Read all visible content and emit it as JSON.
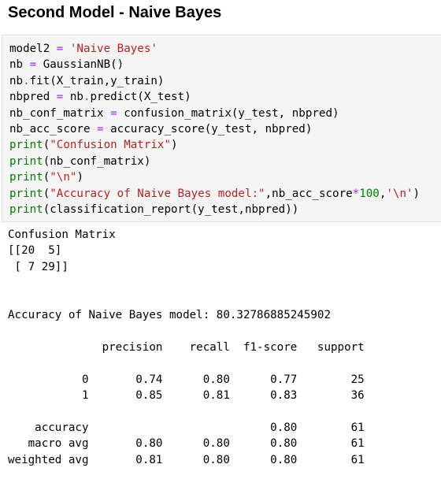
{
  "cell": {
    "heading": "Second Model - Naive Bayes"
  },
  "code": {
    "lines": [
      [
        [
          "v",
          "model2 "
        ],
        [
          "o",
          "="
        ],
        [
          "v",
          " "
        ],
        [
          "s",
          "'Naive Bayes'"
        ]
      ],
      [
        [
          "v",
          "nb "
        ],
        [
          "o",
          "="
        ],
        [
          "v",
          " GaussianNB()"
        ]
      ],
      [
        [
          "v",
          "nb"
        ],
        [
          "o",
          "."
        ],
        [
          "v",
          "fit(X_train,y_train)"
        ]
      ],
      [
        [
          "v",
          "nbpred "
        ],
        [
          "o",
          "="
        ],
        [
          "v",
          " nb"
        ],
        [
          "o",
          "."
        ],
        [
          "v",
          "predict(X_test)"
        ]
      ],
      [
        [
          "v",
          "nb_conf_matrix "
        ],
        [
          "o",
          "="
        ],
        [
          "v",
          " confusion_matrix(y_test, nbpred)"
        ]
      ],
      [
        [
          "v",
          "nb_acc_score "
        ],
        [
          "o",
          "="
        ],
        [
          "v",
          " accuracy_score(y_test, nbpred)"
        ]
      ],
      [
        [
          "k",
          "print"
        ],
        [
          "v",
          "("
        ],
        [
          "s",
          "\"Confusion Matrix\""
        ],
        [
          "v",
          ")"
        ]
      ],
      [
        [
          "k",
          "print"
        ],
        [
          "v",
          "(nb_conf_matrix)"
        ]
      ],
      [
        [
          "k",
          "print"
        ],
        [
          "v",
          "("
        ],
        [
          "s",
          "\"\\n\""
        ],
        [
          "v",
          ")"
        ]
      ],
      [
        [
          "k",
          "print"
        ],
        [
          "v",
          "("
        ],
        [
          "s",
          "\"Accuracy of Naive Bayes model:\""
        ],
        [
          "v",
          ",nb_acc_score"
        ],
        [
          "o",
          "*"
        ],
        [
          "n",
          "100"
        ],
        [
          "v",
          ","
        ],
        [
          "s",
          "'\\n'"
        ],
        [
          "v",
          ")"
        ]
      ],
      [
        [
          "k",
          "print"
        ],
        [
          "v",
          "(classification_report(y_test,nbpred))"
        ]
      ]
    ]
  },
  "output": {
    "lines": [
      "Confusion Matrix",
      "[[20  5]",
      " [ 7 29]]",
      "",
      "",
      "Accuracy of Naive Bayes model: 80.32786885245902",
      "",
      "              precision    recall  f1-score   support",
      "",
      "           0       0.74      0.80      0.77        25",
      "           1       0.85      0.81      0.83        36",
      "",
      "    accuracy                           0.80        61",
      "   macro avg       0.80      0.80      0.80        61",
      "weighted avg       0.81      0.80      0.80        61"
    ]
  }
}
